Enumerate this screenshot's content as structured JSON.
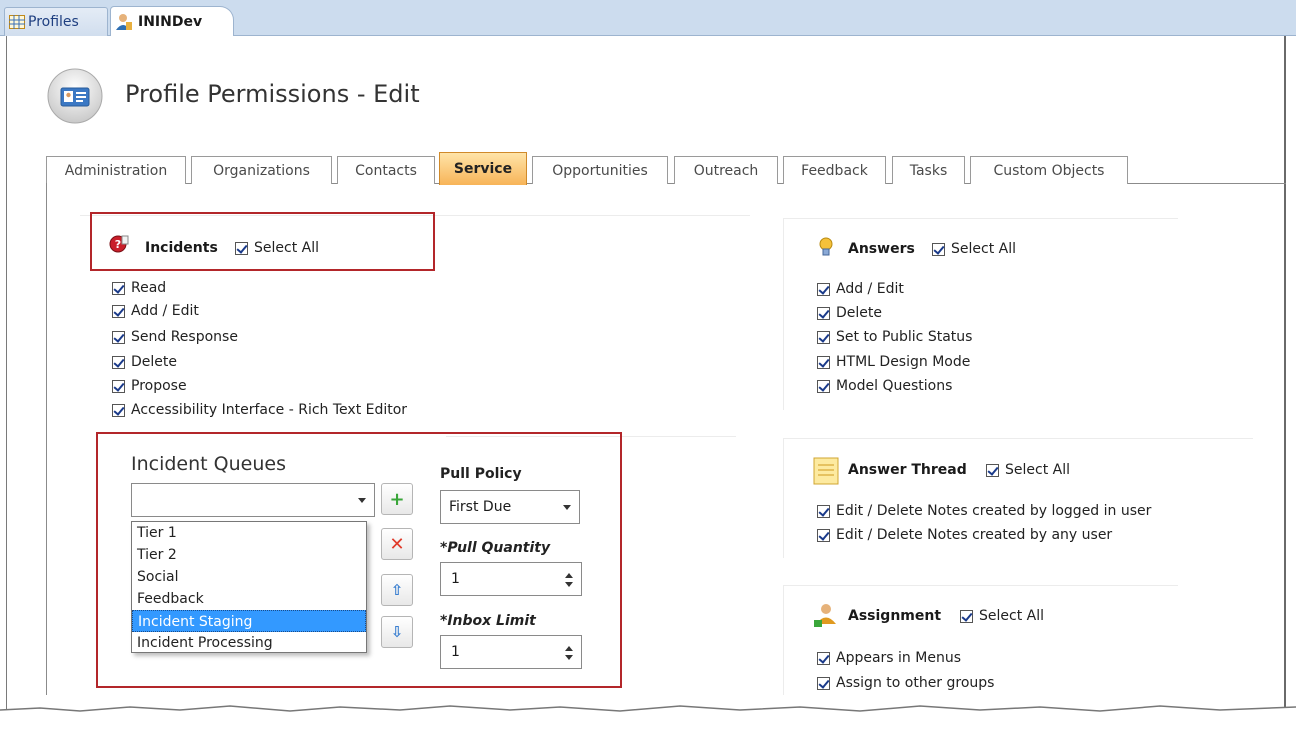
{
  "app_tabs": [
    {
      "label": "Profiles",
      "icon": "grid-icon"
    },
    {
      "label": "ININDev",
      "icon": "person-icon"
    }
  ],
  "page_title": "Profile Permissions - Edit",
  "tabs": [
    "Administration",
    "Organizations",
    "Contacts",
    "Service",
    "Opportunities",
    "Outreach",
    "Feedback",
    "Tasks",
    "Custom Objects"
  ],
  "active_tab": "Service",
  "incidents": {
    "title": "Incidents",
    "select_all": "Select All",
    "items": [
      "Read",
      "Add / Edit",
      "Send Response",
      "Delete",
      "Propose",
      "Accessibility Interface - Rich Text Editor"
    ]
  },
  "queues": {
    "title": "Incident Queues",
    "selected_value": "",
    "options": [
      "Tier 1",
      "Tier 2",
      "Social",
      "Feedback",
      "Incident Staging",
      "Incident Processing"
    ],
    "selected_option": "Incident Staging",
    "pull_policy_label": "Pull Policy",
    "pull_policy_value": "First Due",
    "pull_quantity_label": "*Pull Quantity",
    "pull_quantity_value": "1",
    "inbox_limit_label": "*Inbox Limit",
    "inbox_limit_value": "1"
  },
  "answers": {
    "title": "Answers",
    "select_all": "Select All",
    "items": [
      "Add / Edit",
      "Delete",
      "Set to Public Status",
      "HTML Design Mode",
      "Model Questions"
    ]
  },
  "answer_thread": {
    "title": "Answer Thread",
    "select_all": "Select All",
    "items": [
      "Edit / Delete Notes created by logged in user",
      "Edit / Delete Notes created by any user"
    ]
  },
  "assignment": {
    "title": "Assignment",
    "select_all": "Select All",
    "items": [
      "Appears in Menus",
      "Assign to other groups"
    ]
  },
  "colors": {
    "highlight_box": "#b3262a",
    "active_tab": "#f7b458",
    "selection": "#3399ff"
  }
}
